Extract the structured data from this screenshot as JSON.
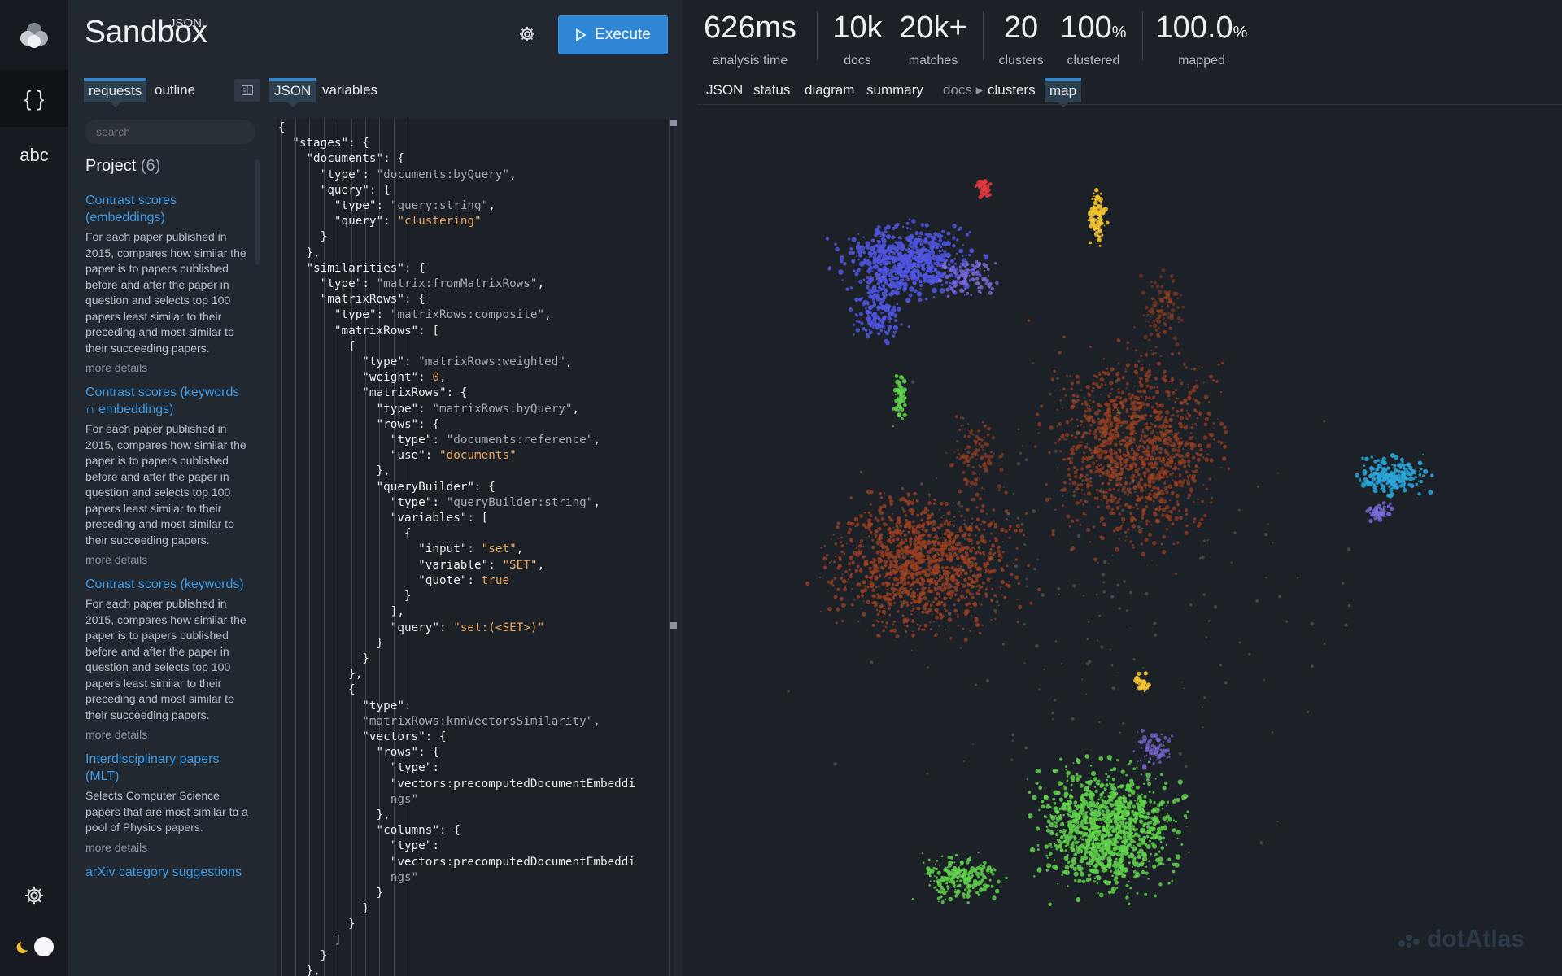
{
  "rail": {
    "icons": [
      "carrotsearch-logo-icon",
      "json-braces-icon",
      "abc-text-icon",
      "settings-gear-icon",
      "theme-toggle"
    ],
    "braces_glyph": "{ }",
    "abc_label": "abc"
  },
  "header": {
    "logo_sup": "JSON",
    "logo_main": "Sandbox",
    "execute_label": "Execute"
  },
  "left_tabs": {
    "requests": "requests",
    "outline": "outline",
    "json": "JSON",
    "variables": "variables"
  },
  "search": {
    "placeholder": "search"
  },
  "project": {
    "title": "Project",
    "count": "(6)"
  },
  "items": [
    {
      "title": "Contrast scores (embeddings)",
      "desc": "For each paper published in 2015, compares how similar the paper is to papers published before and after the paper in question and selects top 100 papers least similar to their preceding and most similar to their succeeding papers.",
      "more": "more details"
    },
    {
      "title": "Contrast scores (keywords ∩ embeddings)",
      "desc": "For each paper published in 2015, compares how similar the paper is to papers published before and after the paper in question and selects top 100 papers least similar to their preceding and most similar to their succeeding papers.",
      "more": "more details"
    },
    {
      "title": "Contrast scores (keywords)",
      "desc": "For each paper published in 2015, compares how similar the paper is to papers published before and after the paper in question and selects top 100 papers least similar to their preceding and most similar to their succeeding papers.",
      "more": "more details"
    },
    {
      "title": "Interdisciplinary papers (MLT)",
      "desc": "Selects Computer Science papers that are most similar to a pool of Physics papers.",
      "more": "more details"
    },
    {
      "title": "arXiv category suggestions",
      "desc": "",
      "more": ""
    }
  ],
  "stats": [
    {
      "value": "626ms",
      "unit": "",
      "label": "analysis time"
    },
    {
      "value": "10k",
      "unit": "",
      "label": "docs"
    },
    {
      "value": "20k+",
      "unit": "",
      "label": "matches"
    },
    {
      "value": "20",
      "unit": "",
      "label": "clusters"
    },
    {
      "value": "100",
      "unit": "%",
      "label": "clustered"
    },
    {
      "value": "100.0",
      "unit": "%",
      "label": "mapped"
    }
  ],
  "right_tabs": [
    "JSON",
    "status",
    "diagram",
    "summary",
    "docs ▸",
    "clusters",
    "map"
  ],
  "right_tab_selected": "map",
  "watermark": "dotAtlas",
  "code_lines": [
    "{",
    "  \"stages\": {",
    "    \"documents\": {",
    "      \"type\": \"documents:byQuery\",",
    "      \"query\": {",
    "        \"type\": \"query:string\",",
    "        \"query\": \"clustering\"",
    "      }",
    "    },",
    "    \"similarities\": {",
    "      \"type\": \"matrix:fromMatrixRows\",",
    "      \"matrixRows\": {",
    "        \"type\": \"matrixRows:composite\",",
    "        \"matrixRows\": [",
    "          {",
    "            \"type\": \"matrixRows:weighted\",",
    "            \"weight\": 0,",
    "            \"matrixRows\": {",
    "              \"type\": \"matrixRows:byQuery\",",
    "              \"rows\": {",
    "                \"type\": \"documents:reference\",",
    "                \"use\": \"documents\"",
    "              },",
    "              \"queryBuilder\": {",
    "                \"type\": \"queryBuilder:string\",",
    "                \"variables\": [",
    "                  {",
    "                    \"input\": \"set\",",
    "                    \"variable\": \"SET\",",
    "                    \"quote\": true",
    "                  }",
    "                ],",
    "                \"query\": \"set:(<SET>)\"",
    "              }",
    "            }",
    "          },",
    "          {",
    "            \"type\":",
    "            \"matrixRows:knnVectorsSimilarity\",",
    "            \"vectors\": {",
    "              \"rows\": {",
    "                \"type\":",
    "                \"vectors:precomputedDocumentEmbeddi",
    "                ngs\"",
    "              },",
    "              \"columns\": {",
    "                \"type\":",
    "                \"vectors:precomputedDocumentEmbeddi",
    "                ngs\"",
    "              }",
    "            }",
    "          }",
    "        ]",
    "      }",
    "    },"
  ],
  "map_clusters": [
    {
      "color": "#4f55e0"
    },
    {
      "color": "#a04020"
    },
    {
      "color": "#5fd04a"
    },
    {
      "color": "#f2c230"
    },
    {
      "color": "#2aa6d8"
    },
    {
      "color": "#e0353e"
    }
  ]
}
